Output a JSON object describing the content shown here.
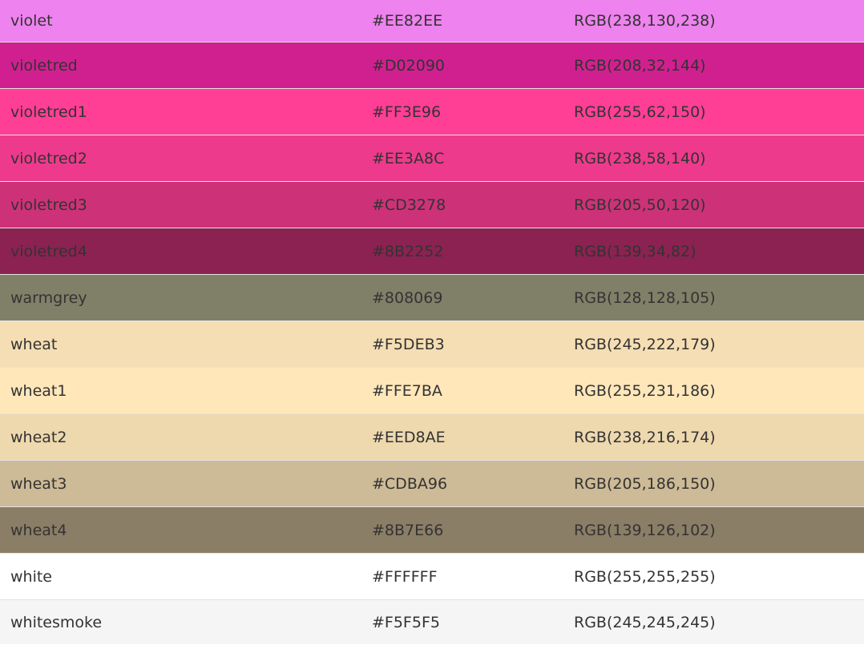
{
  "table": {
    "rows": [
      {
        "name": "violet",
        "hex": "#EE82EE",
        "rgb": "RGB(238,130,238)",
        "swatch": "#EE82EE"
      },
      {
        "name": "violetred",
        "hex": "#D02090",
        "rgb": "RGB(208,32,144)",
        "swatch": "#D02090"
      },
      {
        "name": "violetred1",
        "hex": "#FF3E96",
        "rgb": "RGB(255,62,150)",
        "swatch": "#FF3E96"
      },
      {
        "name": "violetred2",
        "hex": "#EE3A8C",
        "rgb": "RGB(238,58,140)",
        "swatch": "#EE3A8C"
      },
      {
        "name": "violetred3",
        "hex": "#CD3278",
        "rgb": "RGB(205,50,120)",
        "swatch": "#CD3278"
      },
      {
        "name": "violetred4",
        "hex": "#8B2252",
        "rgb": "RGB(139,34,82)",
        "swatch": "#8B2252"
      },
      {
        "name": "warmgrey",
        "hex": "#808069",
        "rgb": "RGB(128,128,105)",
        "swatch": "#808069"
      },
      {
        "name": "wheat",
        "hex": "#F5DEB3",
        "rgb": "RGB(245,222,179)",
        "swatch": "#F5DEB3"
      },
      {
        "name": "wheat1",
        "hex": "#FFE7BA",
        "rgb": "RGB(255,231,186)",
        "swatch": "#FFE7BA"
      },
      {
        "name": "wheat2",
        "hex": "#EED8AE",
        "rgb": "RGB(238,216,174)",
        "swatch": "#EED8AE"
      },
      {
        "name": "wheat3",
        "hex": "#CDBA96",
        "rgb": "RGB(205,186,150)",
        "swatch": "#CDBA96"
      },
      {
        "name": "wheat4",
        "hex": "#8B7E66",
        "rgb": "RGB(139,126,102)",
        "swatch": "#8B7E66"
      },
      {
        "name": "white",
        "hex": "#FFFFFF",
        "rgb": "RGB(255,255,255)",
        "swatch": "#FFFFFF"
      },
      {
        "name": "whitesmoke",
        "hex": "#F5F5F5",
        "rgb": "RGB(245,245,245)",
        "swatch": "#F5F5F5"
      }
    ]
  }
}
